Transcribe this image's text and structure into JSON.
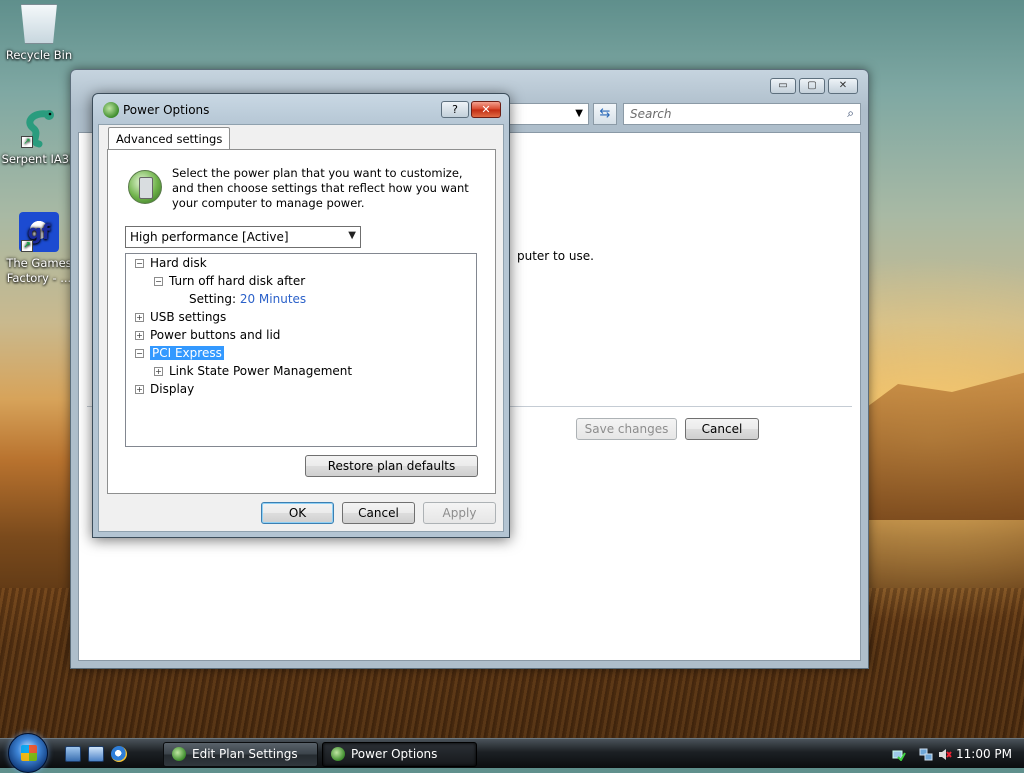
{
  "desktop": {
    "icons": [
      {
        "label": "Recycle Bin"
      },
      {
        "label": "Serpent IA32"
      },
      {
        "label": "The Games Factory - ..."
      }
    ]
  },
  "background_window": {
    "search_placeholder": "Search",
    "body_text": "puter to use.",
    "save_label": "Save changes",
    "cancel_label": "Cancel",
    "window_buttons": {
      "minimize": "▭",
      "maximize": "▢",
      "close": "✕"
    }
  },
  "dialog": {
    "title": "Power Options",
    "help_label": "?",
    "close_label": "✕",
    "tab_label": "Advanced settings",
    "description": "Select the power plan that you want to customize, and then choose settings that reflect how you want your computer to manage power.",
    "plan_selected": "High performance [Active]",
    "tree": {
      "hard_disk": "Hard disk",
      "turn_off_hd": "Turn off hard disk after",
      "setting_label": "Setting:",
      "setting_value": "20 Minutes",
      "usb": "USB settings",
      "power_buttons": "Power buttons and lid",
      "pci": "PCI Express",
      "link_state": "Link State Power Management",
      "display": "Display"
    },
    "restore_label": "Restore plan defaults",
    "ok_label": "OK",
    "cancel_label": "Cancel",
    "apply_label": "Apply"
  },
  "taskbar": {
    "tasks": [
      {
        "label": "Edit Plan Settings"
      },
      {
        "label": "Power Options"
      }
    ],
    "clock": "11:00 PM"
  },
  "colors": {
    "selection": "#3399ff",
    "setting_value": "#2b61c9"
  }
}
